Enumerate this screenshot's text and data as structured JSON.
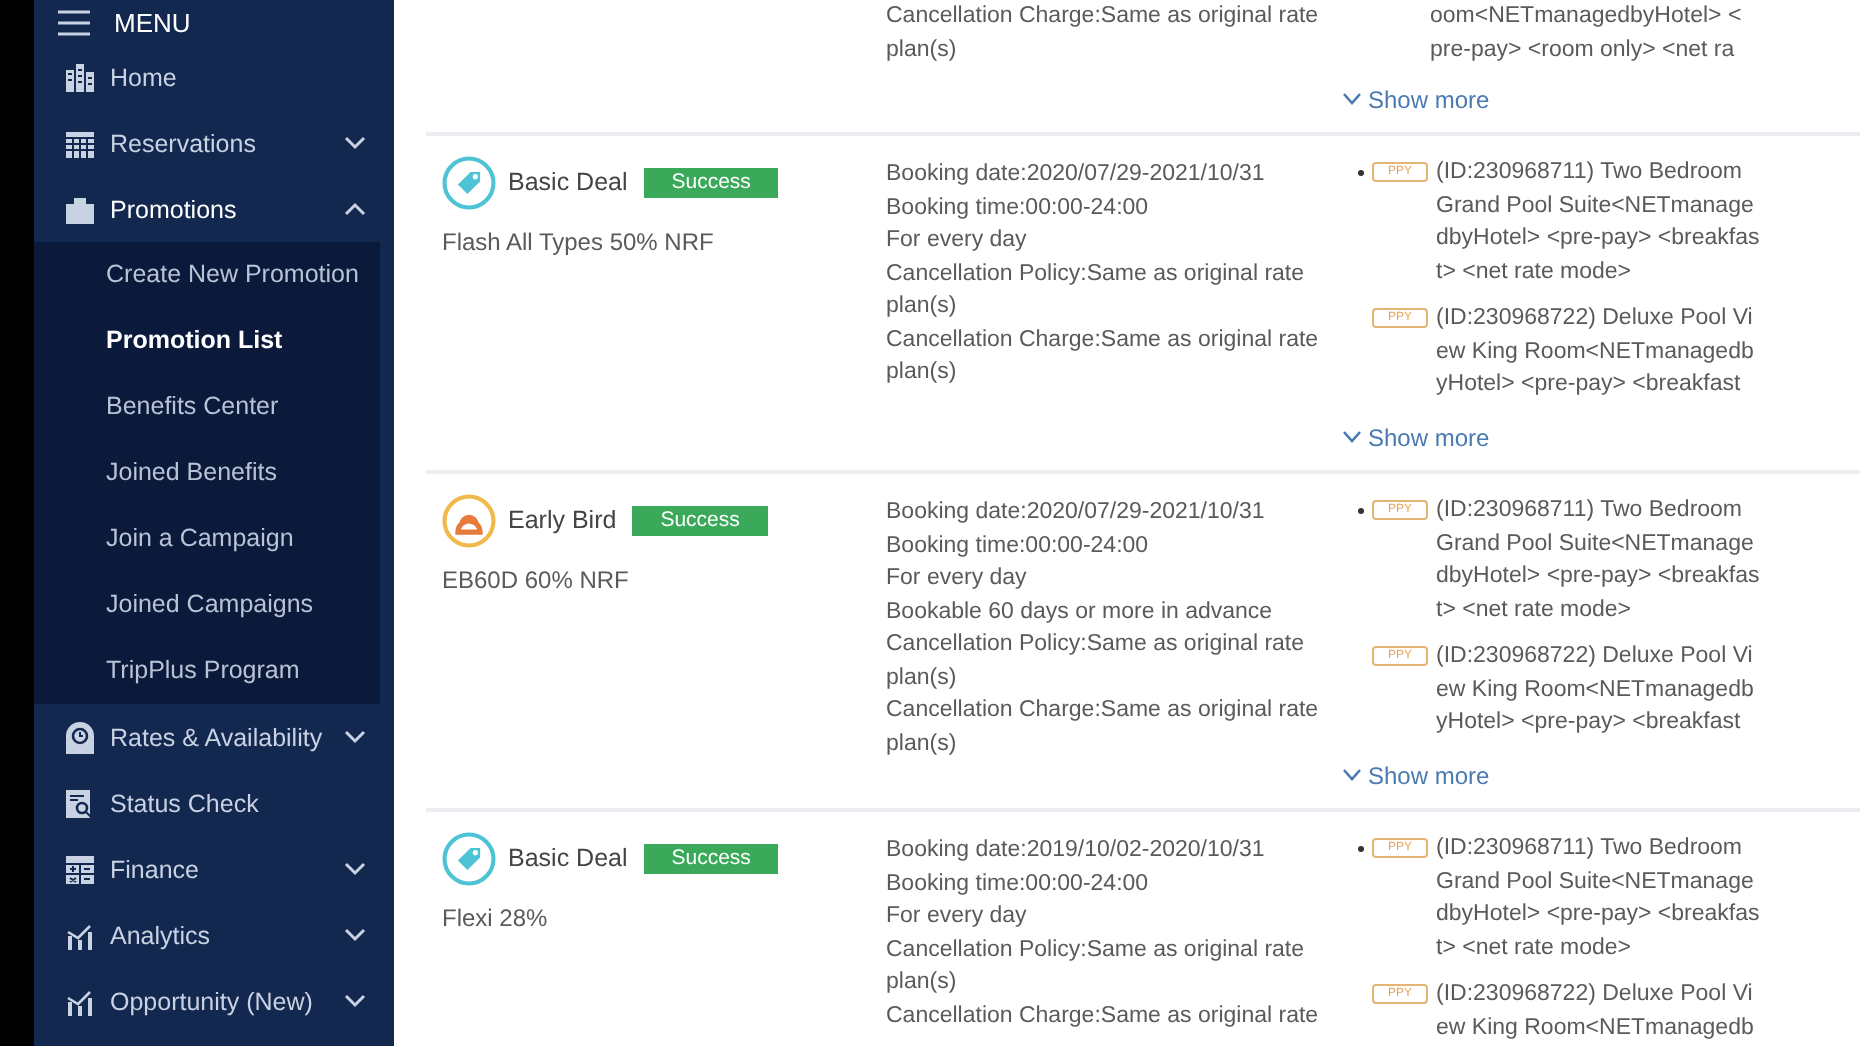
{
  "menu": {
    "title": "MENU"
  },
  "sidebar": {
    "items": [
      {
        "label": "Home",
        "kind": "home"
      },
      {
        "label": "Reservations",
        "kind": "calendar",
        "expanded": false
      },
      {
        "label": "Promotions",
        "kind": "tag",
        "expanded": true,
        "children": [
          {
            "label": "Create New Promotion",
            "selected": false
          },
          {
            "label": "Promotion List",
            "selected": true
          },
          {
            "label": "Benefits Center",
            "selected": false
          },
          {
            "label": "Joined Benefits",
            "selected": false
          },
          {
            "label": "Join a Campaign",
            "selected": false
          },
          {
            "label": "Joined Campaigns",
            "selected": false
          },
          {
            "label": "TripPlus Program",
            "selected": false
          }
        ]
      },
      {
        "label": "Rates & Availability",
        "kind": "clock",
        "expanded": false
      },
      {
        "label": "Status Check",
        "kind": "search"
      },
      {
        "label": "Finance",
        "kind": "calculator",
        "expanded": false
      },
      {
        "label": "Analytics",
        "kind": "chart",
        "expanded": false
      },
      {
        "label": "Opportunity (New)",
        "kind": "chart",
        "expanded": false
      }
    ]
  },
  "promotions": [
    {
      "details": [
        "Cancellation Charge:Same as original rate plan(s)"
      ],
      "rooms": [
        {
          "text": "oom<NETmanagedbyHotel> <pre-pay> <room only> <net ra"
        }
      ],
      "show_more": "Show more"
    },
    {
      "kind": "basic",
      "type": "Basic Deal",
      "status": "Success",
      "name": "Flash All Types 50% NRF",
      "details": [
        "Booking date:2020/07/29-2021/10/31",
        "Booking time:00:00-24:00",
        "For every day",
        "Cancellation Policy:Same as original rate plan(s)",
        "Cancellation Charge:Same as original rate plan(s)"
      ],
      "rooms": [
        {
          "tag": "PPY",
          "text": "(ID:230968711) Two Bedroom Grand Pool Suite<NETmanagedbyHotel> <pre-pay> <breakfast> <net rate mode>"
        },
        {
          "tag": "PPY",
          "text": "(ID:230968722) Deluxe Pool View King Room<NETmanagedbyHotel> <pre-pay> <breakfast"
        }
      ],
      "show_more": "Show more"
    },
    {
      "kind": "early",
      "type": "Early Bird",
      "status": "Success",
      "name": "EB60D 60% NRF",
      "details": [
        "Booking date:2020/07/29-2021/10/31",
        "Booking time:00:00-24:00",
        "For every day",
        "Bookable 60 days or more in advance",
        "Cancellation Policy:Same as original rate plan(s)",
        "Cancellation Charge:Same as original rate plan(s)"
      ],
      "rooms": [
        {
          "tag": "PPY",
          "text": "(ID:230968711) Two Bedroom Grand Pool Suite<NETmanagedbyHotel> <pre-pay> <breakfast> <net rate mode>"
        },
        {
          "tag": "PPY",
          "text": "(ID:230968722) Deluxe Pool View King Room<NETmanagedbyHotel> <pre-pay> <breakfast"
        }
      ],
      "show_more": "Show more"
    },
    {
      "kind": "basic",
      "type": "Basic Deal",
      "status": "Success",
      "name": "Flexi 28%",
      "details": [
        "Booking date:2019/10/02-2020/10/31",
        "Booking time:00:00-24:00",
        "For every day",
        "Cancellation Policy:Same as original rate plan(s)",
        "Cancellation Charge:Same as original rate"
      ],
      "rooms": [
        {
          "tag": "PPY",
          "text": "(ID:230968711) Two Bedroom Grand Pool Suite<NETmanagedbyHotel> <pre-pay> <breakfast> <net rate mode>"
        },
        {
          "tag": "PPY",
          "text": "(ID:230968722) Deluxe Pool View King Room<NETmanagedb"
        }
      ]
    }
  ]
}
